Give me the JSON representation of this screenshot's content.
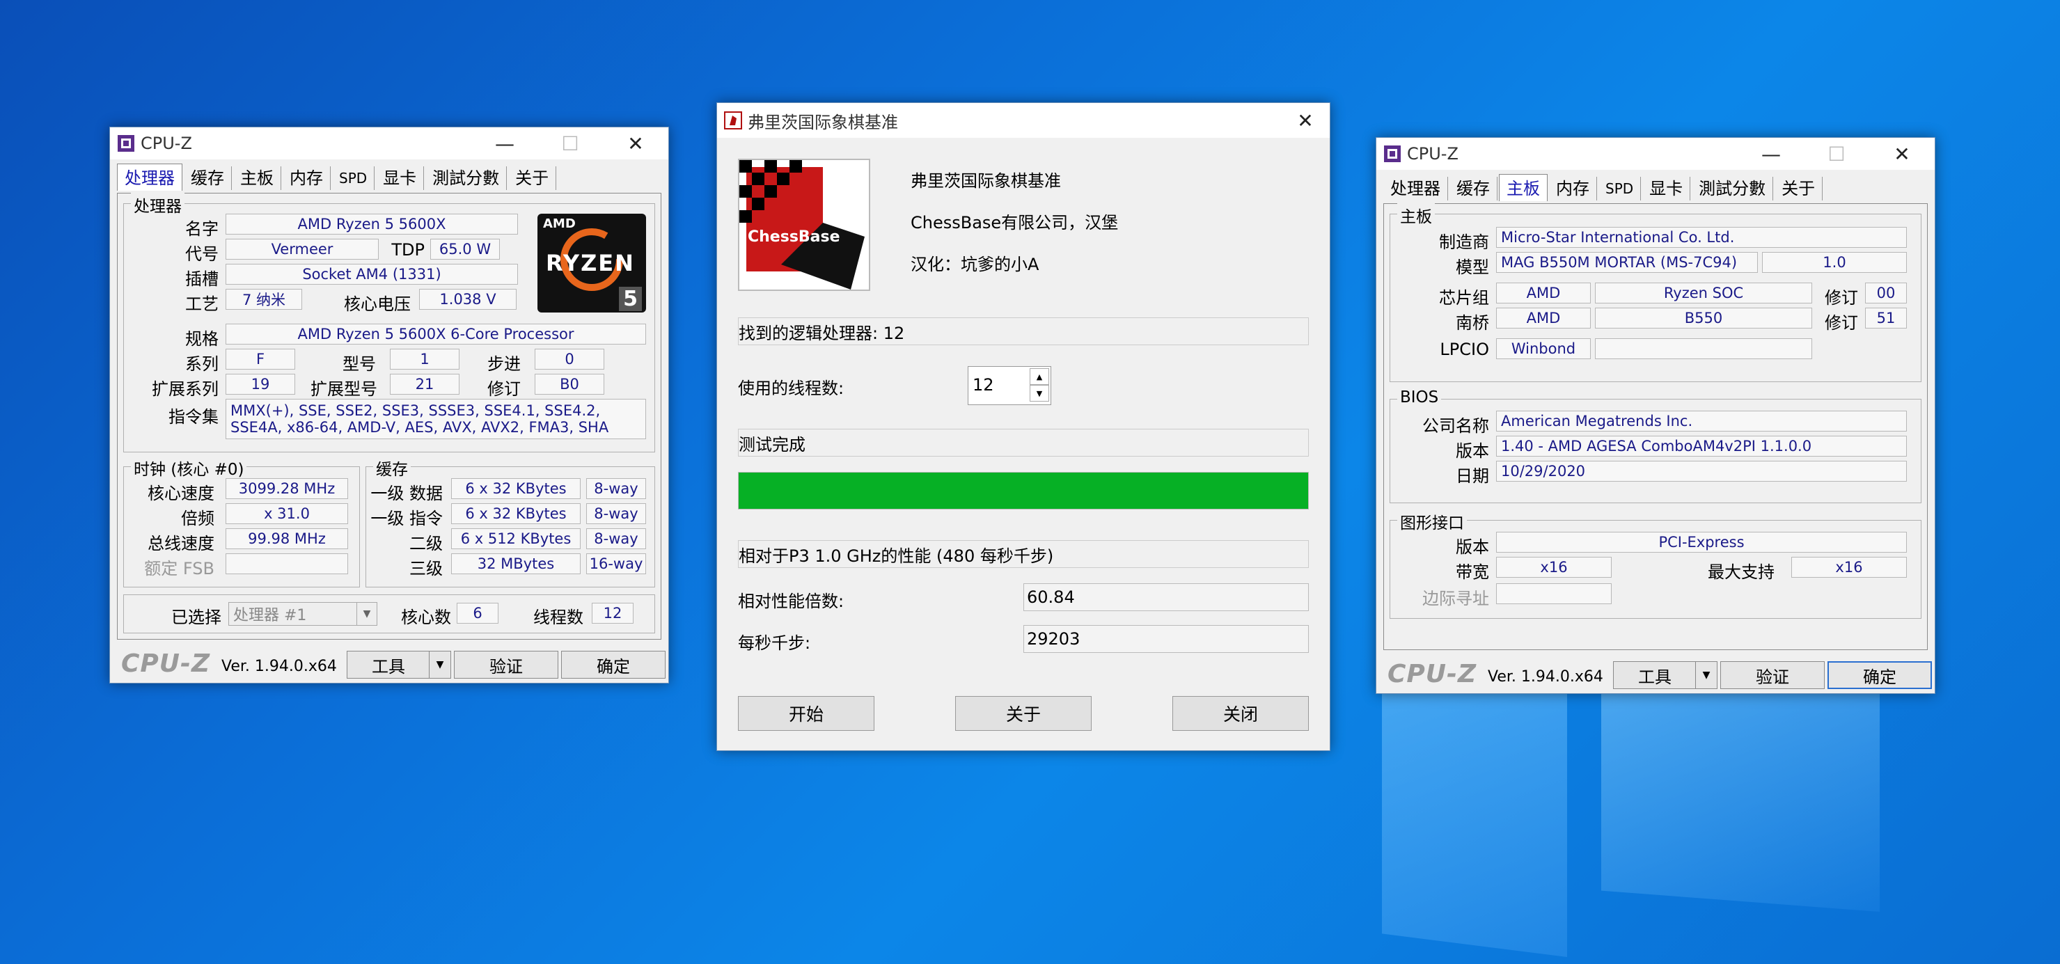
{
  "cpuz_left": {
    "title": "CPU-Z",
    "tabs": [
      "处理器",
      "缓存",
      "主板",
      "内存",
      "SPD",
      "显卡",
      "測試分數",
      "关于"
    ],
    "processor_group": "处理器",
    "labels": {
      "name": "名字",
      "code": "代号",
      "tdp": "TDP",
      "socket": "插槽",
      "tech": "工艺",
      "voltage": "核心电压",
      "spec": "规格",
      "family": "系列",
      "model": "型号",
      "stepping": "步进",
      "ext_family": "扩展系列",
      "ext_model": "扩展型号",
      "revision": "修订",
      "instructions": "指令集"
    },
    "values": {
      "name": "AMD Ryzen 5 5600X",
      "code": "Vermeer",
      "tdp": "65.0 W",
      "socket": "Socket AM4 (1331)",
      "tech": "7 纳米",
      "voltage": "1.038 V",
      "spec": "AMD Ryzen 5 5600X 6-Core Processor",
      "family": "F",
      "model": "1",
      "stepping": "0",
      "ext_family": "19",
      "ext_model": "21",
      "revision": "B0",
      "instructions": "MMX(+), SSE, SSE2, SSE3, SSSE3, SSE4.1, SSE4.2, SSE4A, x86-64, AMD-V, AES, AVX, AVX2, FMA3, SHA"
    },
    "logo": {
      "brand": "AMD",
      "line": "RYZEN",
      "num": "5"
    },
    "clock_group": "时钟 (核心 #0)",
    "clock_labels": {
      "core_speed": "核心速度",
      "multiplier": "倍频",
      "bus_speed": "总线速度",
      "rated_fsb": "额定 FSB"
    },
    "clock_values": {
      "core_speed": "3099.28 MHz",
      "multiplier": "x 31.0",
      "bus_speed": "99.98 MHz",
      "rated_fsb": ""
    },
    "cache_group": "缓存",
    "cache_rows": [
      {
        "label": "一级 数据",
        "size": "6 x 32 KBytes",
        "way": "8-way"
      },
      {
        "label": "一级 指令",
        "size": "6 x 32 KBytes",
        "way": "8-way"
      },
      {
        "label": "二级",
        "size": "6 x 512 KBytes",
        "way": "8-way"
      },
      {
        "label": "三级",
        "size": "32 MBytes",
        "way": "16-way"
      }
    ],
    "selection_label": "已选择",
    "selection_value": "处理器 #1",
    "cores_label": "核心数",
    "cores_value": "6",
    "threads_label": "线程数",
    "threads_value": "12",
    "brand": "CPU-Z",
    "version": "Ver. 1.94.0.x64",
    "btn_tools": "工具",
    "btn_validate": "验证",
    "btn_ok": "确定"
  },
  "chess": {
    "title": "弗里茨国际象棋基准",
    "logo_text": "ChessBase",
    "heading": "弗里茨国际象棋基准",
    "company": "ChessBase有限公司，汉堡",
    "localized": "汉化：坑爹的小A",
    "found_processors": "找到的逻辑处理器: 12",
    "threads_label": "使用的线程数:",
    "threads_value": "12",
    "status": "测试完成",
    "progress": 1.0,
    "progress_color": "#06b025",
    "relative_note": "相对于P3 1.0 GHz的性能 (480 每秒千步)",
    "ratio_label": "相对性能倍数:",
    "ratio_value": "60.84",
    "knps_label": "每秒千步:",
    "knps_value": "29203",
    "btn_start": "开始",
    "btn_about": "关于",
    "btn_close": "关闭"
  },
  "cpuz_right": {
    "title": "CPU-Z",
    "tabs": [
      "处理器",
      "缓存",
      "主板",
      "内存",
      "SPD",
      "显卡",
      "測試分數",
      "关于"
    ],
    "mb_group": "主板",
    "mb": {
      "maker_label": "制造商",
      "maker": "Micro-Star International Co. Ltd.",
      "model_label": "模型",
      "model": "MAG B550M MORTAR (MS-7C94)",
      "model_rev": "1.0",
      "chipset_label": "芯片组",
      "chipset_vendor": "AMD",
      "chipset": "Ryzen SOC",
      "chipset_rev_label": "修订",
      "chipset_rev": "00",
      "south_label": "南桥",
      "south_vendor": "AMD",
      "south": "B550",
      "south_rev_label": "修订",
      "south_rev": "51",
      "lpcio_label": "LPCIO",
      "lpcio": "Winbond"
    },
    "bios_group": "BIOS",
    "bios": {
      "brand_label": "公司名称",
      "brand": "American Megatrends Inc.",
      "ver_label": "版本",
      "ver": "1.40 - AMD AGESA ComboAM4v2PI 1.1.0.0",
      "date_label": "日期",
      "date": "10/29/2020"
    },
    "gfx_group": "图形接口",
    "gfx": {
      "ver_label": "版本",
      "ver": "PCI-Express",
      "width_label": "带宽",
      "width": "x16",
      "max_label": "最大支持",
      "max": "x16",
      "side_label": "边际寻址"
    },
    "brand": "CPU-Z",
    "version": "Ver. 1.94.0.x64",
    "btn_tools": "工具",
    "btn_validate": "验证",
    "btn_ok": "确定"
  }
}
